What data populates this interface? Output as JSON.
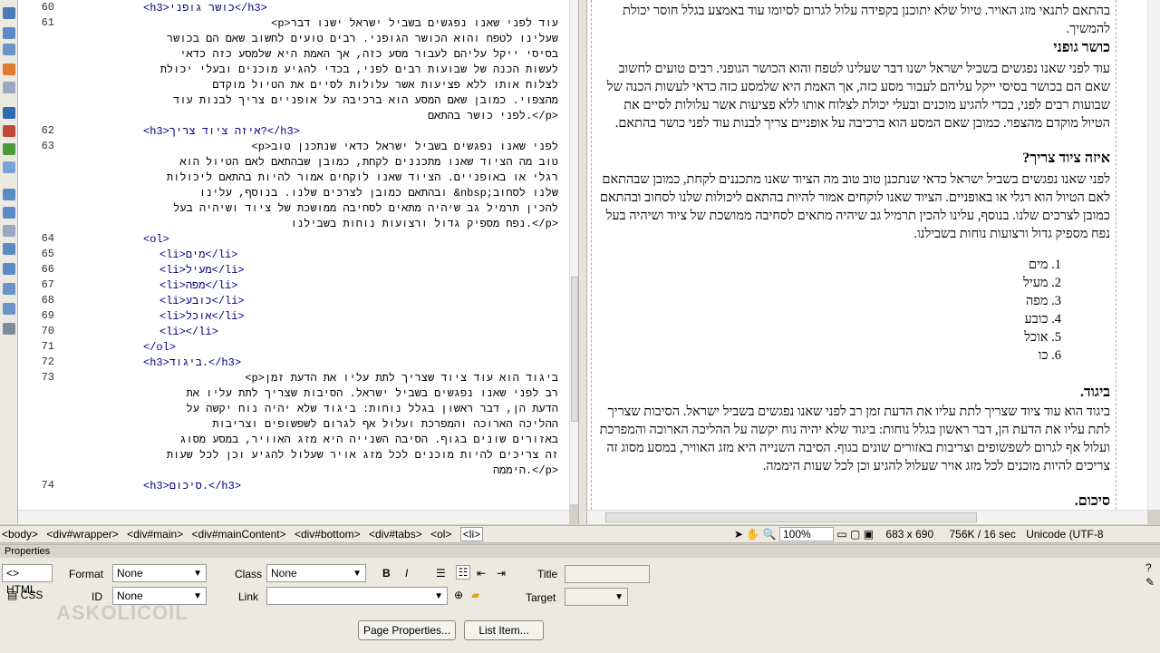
{
  "code_view": {
    "lines": [
      {
        "num": "60",
        "text": "<h3>כושר גופני</h3>"
      },
      {
        "num": "61",
        "text": "<p>עוד לפני שאנו נפגשים בשביל ישראל ישנו דבר"
      },
      {
        "num": "",
        "text": "שעלינו לטפח והוא הכושר הגופני. רבים טועים לחשוב שאם הם בכושר"
      },
      {
        "num": "",
        "text": "בסיסי ייקל עליהם לעבור מסע כזה, אך האמת היא שלמסע כזה כדאי"
      },
      {
        "num": "",
        "text": "לעשות הכנה של שבועות רבים לפני, בכדי להגיע מוכנים ובעלי יכולת"
      },
      {
        "num": "",
        "text": "לצלוח אותו ללא פציעות אשר עלולות לסיים את הטיול מוקדם"
      },
      {
        "num": "",
        "text": "מהצפוי. כמובן שאם המסע הוא ברכיבה על אופניים צריך לבנות עוד"
      },
      {
        "num": "",
        "text": "לפני כושר בהתאם.</p>"
      },
      {
        "num": "62",
        "text": "<h3>איזה ציוד צריך?</h3>"
      },
      {
        "num": "63",
        "text": "<p>לפני שאנו נפגשים בשביל ישראל כדאי שנתכנן טוב"
      },
      {
        "num": "",
        "text": "טוב מה הציוד שאנו מתכננים לקחת, כמובן שבהתאם לאם הטיול הוא"
      },
      {
        "num": "",
        "text": "רגלי או באופניים. הציוד שאנו לוקחים אמור להיות בהתאם ליכולות"
      },
      {
        "num": "",
        "text": "ובהתאם כמובן לצרכים שלנו. בנוסף, עלינו &nbsp;שלנו לסחוב"
      },
      {
        "num": "",
        "text": "להכין תרמיל גב שיהיה מתאים לסחיבה ממושכת של ציוד ושיהיה בעל"
      },
      {
        "num": "",
        "text": "נפח מספיק גדול ורצועות נוחות בשבילנו.</p>"
      },
      {
        "num": "64",
        "text": "<ol>"
      },
      {
        "num": "65",
        "text": "<li>מים</li>"
      },
      {
        "num": "66",
        "text": "<li>מעיל</li>"
      },
      {
        "num": "67",
        "text": "<li>מפה</li>"
      },
      {
        "num": "68",
        "text": "<li>כובע</li>"
      },
      {
        "num": "69",
        "text": "<li>אוכל</li>"
      },
      {
        "num": "70",
        "text": "<li></li>"
      },
      {
        "num": "71",
        "text": "</ol>"
      },
      {
        "num": "72",
        "text": "<h3>ביגוד.</h3>"
      },
      {
        "num": "73",
        "text": "<p>ביגוד הוא עוד ציוד שצריך לתת עליו את הדעת זמן"
      },
      {
        "num": "",
        "text": "רב לפני שאנו נפגשים בשביל ישראל. הסיבות שצריך לתת עליו את"
      },
      {
        "num": "",
        "text": "הדעת הן, דבר ראשון בגלל נוחות: ביגוד שלא יהיה נוח יקשה על"
      },
      {
        "num": "",
        "text": "ההליכה הארוכה והמפרכת ועלול אף לגרום לשפשופים וצריבות"
      },
      {
        "num": "",
        "text": "באזורים שונים בגוף. הסיבה השנייה היא מזג האוויר, במסע מסוג"
      },
      {
        "num": "",
        "text": "זה צריכים להיות מוכנים לכל מזג אויר שעלול להגיע וכן לכל שעות"
      },
      {
        "num": "",
        "text": "היממה.</p>"
      },
      {
        "num": "74",
        "text": "<h3>סיכום.</h3>"
      }
    ]
  },
  "design_view": {
    "top_fragment": "בהתאם לתנאי מזג האויר. טיול שלא יתוכנן בקפידה עלול לגרום לסיומו עוד באמצע בגלל חוסר יכולת להמשיך.",
    "h_fitness": "כושר גופני",
    "p_fitness": "עוד לפני שאנו נפגשים בשביל ישראל ישנו דבר שעלינו לטפח והוא הכושר הגופני. רבים טועים לחשוב שאם הם בכושר בסיסי ייקל עליהם לעבור מסע כזה, אך האמת היא שלמסע כזה כדאי לעשות הכנה של שבועות רבים לפני, בכדי להגיע מוכנים ובעלי יכולת לצלוח אותו ללא פציעות אשר עלולות לסיים את הטיול מוקדם מהצפוי. כמובן שאם המסע הוא ברכיבה על אופניים צריך לבנות עוד לפני כושר בהתאם.",
    "h_gear": "איזה ציוד צריך?",
    "p_gear": "לפני שאנו נפגשים בשביל ישראל כדאי שנתכנן טוב טוב מה הציוד שאנו מתכננים לקחת, כמובן שבהתאם לאם הטיול הוא רגלי או באופניים. הציוד שאנו לוקחים אמור להיות בהתאם ליכולות שלנו לסחוב ובהתאם כמובן לצרכים שלנו. בנוסף, עלינו להכין תרמיל גב שיהיה מתאים לסחיבה ממושכת של ציוד ושיהיה בעל נפח מספיק גדול ורצועות נוחות בשבילנו.",
    "list": [
      "1.  מים",
      "2.  מעיל",
      "3.  מפה",
      "4.  כובע",
      "5.  אוכל",
      "6.  כו"
    ],
    "h_clothing": "ביגוד.",
    "p_clothing": "ביגוד הוא עוד ציוד שצריך לתת עליו את הדעת זמן רב לפני שאנו נפגשים בשביל ישראל. הסיבות שצריך לתת עליו את הדעת הן, דבר ראשון בגלל נוחות: ביגוד שלא יהיה נוח יקשה על ההליכה הארוכה והמפרכת ועלול אף לגרום לשפשופים וצריבות באזורים שונים בגוף. הסיבה השנייה היא מזג האוויר, במסע מסוג זה צריכים להיות מוכנים לכל מזג אויר שעלול להגיע וכן לכל שעות היממה.",
    "h_summary": "סיכום."
  },
  "status_bar": {
    "tags": [
      "<body>",
      "<div#wrapper>",
      "<div#main>",
      "<div#mainContent>",
      "<div#bottom>",
      "<div#tabs>",
      "<ol>"
    ],
    "active_tag": "<li>",
    "zoom": "100%",
    "dimensions": "683 x 690",
    "download": "756K / 16 sec",
    "encoding": "Unicode (UTF-8"
  },
  "properties": {
    "title": "Properties",
    "html_label": "HTML",
    "css_label": "CSS",
    "format_label": "Format",
    "format_value": "None",
    "class_label": "Class",
    "class_value": "None",
    "id_label": "ID",
    "id_value": "None",
    "link_label": "Link",
    "title_label": "Title",
    "target_label": "Target",
    "bold": "B",
    "italic": "I",
    "page_properties": "Page Properties...",
    "list_item": "List Item..."
  },
  "watermark": "ASKOLICOIL"
}
